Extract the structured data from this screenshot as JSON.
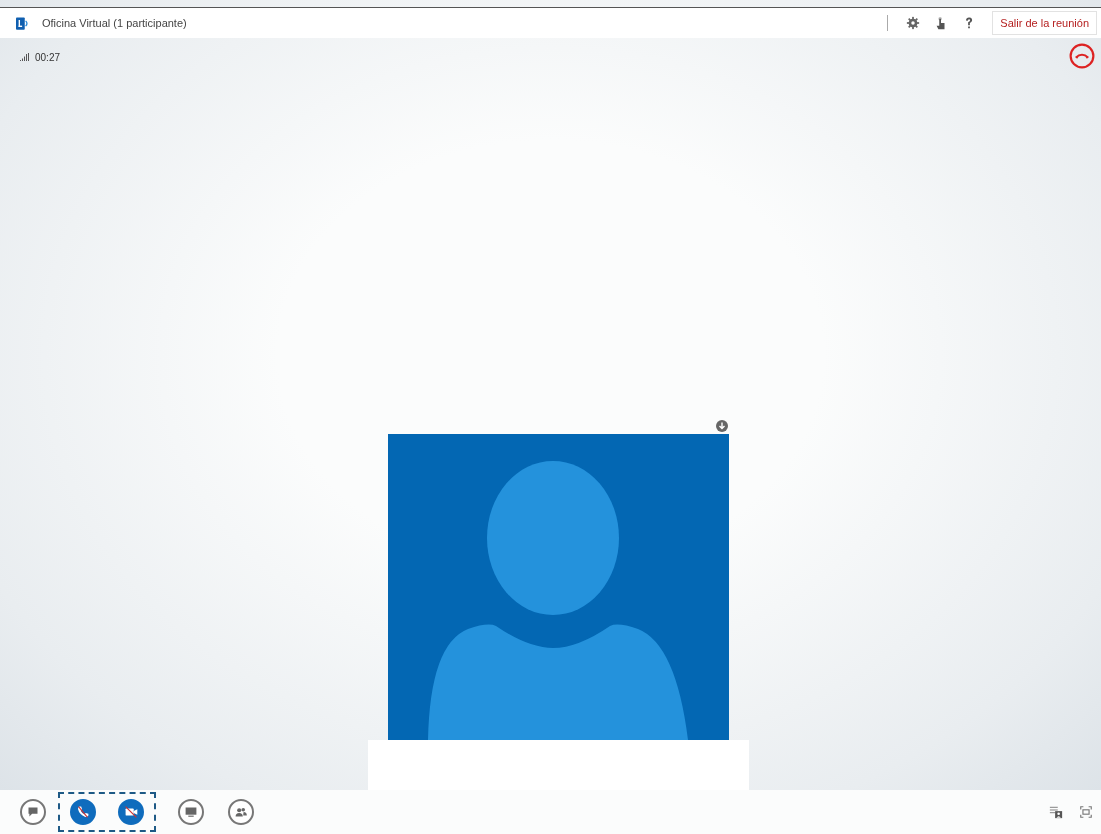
{
  "window": {
    "title": "Oficina Virtual (1 participante)"
  },
  "header": {
    "leave_button": "Salir de la reunión"
  },
  "call": {
    "duration": "00:27"
  },
  "toolbar": [
    {
      "kind": "chat",
      "active": false
    },
    {
      "kind": "audio",
      "active": true
    },
    {
      "kind": "video",
      "active": true
    },
    {
      "kind": "present",
      "active": false
    },
    {
      "kind": "people",
      "active": false
    }
  ]
}
